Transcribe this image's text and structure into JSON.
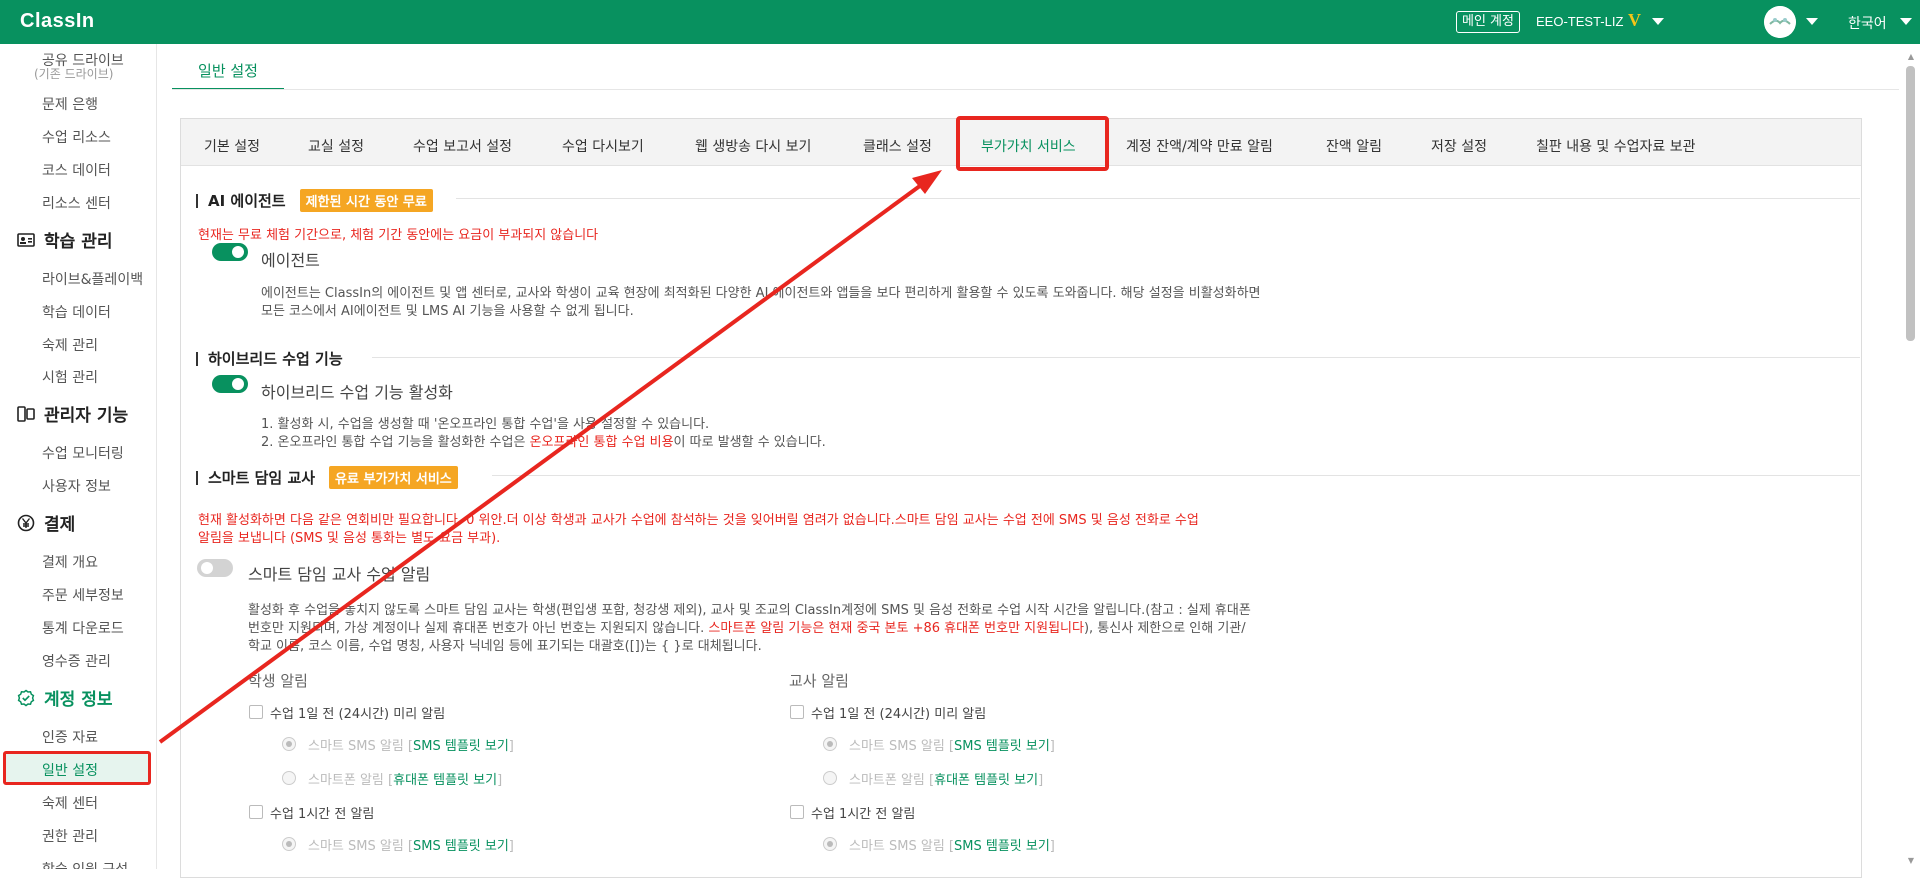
{
  "header": {
    "logo": "ClassIn",
    "main_account_label": "메인 계정",
    "account_name": "EEO-TEST-LIZ",
    "vip_badge": "V",
    "language": "한국어"
  },
  "sidebar": {
    "top_items": [
      {
        "label": "공유 드라이브",
        "sub": "(기존 드라이브)"
      },
      {
        "label": "문제 은행"
      },
      {
        "label": "수업 리소스"
      },
      {
        "label": "코스 데이터"
      },
      {
        "label": "리소스 센터"
      }
    ],
    "groups": [
      {
        "title": "학습 관리",
        "icon": "id-card-icon",
        "items": [
          "라이브&플레이백",
          "학습 데이터",
          "숙제 관리",
          "시험 관리"
        ]
      },
      {
        "title": "관리자 기능",
        "icon": "admin-device-icon",
        "items": [
          "수업 모니터링",
          "사용자 정보"
        ]
      },
      {
        "title": "결제",
        "icon": "yen-circle-icon",
        "items": [
          "결제 개요",
          "주문 세부정보",
          "통계 다운로드",
          "영수증 관리"
        ]
      },
      {
        "title": "계정 정보",
        "icon": "account-check-icon",
        "items": [
          "인증 자료",
          "일반 설정",
          "숙제 센터",
          "권한 관리",
          "학습 인원 구성"
        ]
      }
    ],
    "active_item": "일반 설정"
  },
  "page": {
    "tab": "일반 설정"
  },
  "tabs": [
    "기본 설정",
    "교실 설정",
    "수업 보고서 설정",
    "수업 다시보기",
    "웹 생방송 다시 보기",
    "클래스 설정",
    "부가가치 서비스",
    "계정 잔액/계약 만료 알림",
    "잔액 알림",
    "저장 설정",
    "칠판 내용 및 수업자료 보관"
  ],
  "active_tab": "부가가치 서비스",
  "sections": {
    "ai": {
      "title": "AI 에이전트",
      "badge": "제한된 시간 동안 무료",
      "notice": "현재는 무료 체험 기간으로, 체험 기간 동안에는 요금이 부과되지 않습니다",
      "toggle_label": "에이전트",
      "toggle_on": true,
      "desc_line1": "에이전트는 ClassIn의 에이전트 및 앱 센터로, 교사와 학생이 교육 현장에 최적화된 다양한 AI 에이전트와 앱들을 보다 편리하게 활용할 수 있도록 도와줍니다. 해당 설정을 비활성화하면",
      "desc_line2": "모든 코스에서 AI에이전트 및 LMS AI 기능을 사용할 수 없게 됩니다."
    },
    "hybrid": {
      "title": "하이브리드 수업 기능",
      "toggle_label": "하이브리드 수업 기능 활성화",
      "toggle_on": true,
      "line1": "1. 활성화 시, 수업을 생성할 때 '온오프라인 통합 수업'을 사용 설정할 수 있습니다.",
      "line2_pre": "2. 온오프라인 통합 수업 기능을 활성화한 수업은 ",
      "line2_red": "온오프라인 통합 수업 비용",
      "line2_post": "이 따로 발생할 수 있습니다."
    },
    "smart": {
      "title": "스마트 담임 교사",
      "badge": "유료 부가가치 서비스",
      "notice_line1": "현재 활성화하면 다음 같은 연회비만 필요합니다. 0 위안.더 이상 학생과 교사가 수업에 참석하는 것을 잊어버릴 염려가 없습니다.스마트 담임 교사는 수업 전에 SMS 및 음성 전화로 수업",
      "notice_line2": "알림을 보냅니다 (SMS 및 음성 통화는 별도 요금 부과).",
      "toggle_label": "스마트 담임 교사 수업 알림",
      "toggle_on": false,
      "desc_line1": "활성화 후 수업을 놓치지 않도록 스마트 담임 교사는 학생(편입생 포함, 청강생 제외), 교사 및 조교의 ClassIn계정에 SMS 및 음성 전화로 수업 시작 시간을 알립니다.(참고 : 실제 휴대폰",
      "desc_line2_pre": "번호만 지원되며, 가상 계정이나 실제 휴대폰 번호가 아닌 번호는 지원되지 않습니다. ",
      "desc_line2_red": "스마트폰 알림 기능은 현재 중국 본토 +86 휴대폰 번호만 지원됩니다",
      "desc_line2_post": "), 통신사 제한으로 인해 기관/",
      "desc_line3": "학교 이름, 코스 이름, 수업 명칭, 사용자 닉네임 등에 표기되는 대괄호([])는 { }로 대체됩니다.",
      "student_col": "학생 알림",
      "teacher_col": "교사 알림",
      "opt_24h": "수업 1일 전 (24시간) 미리 알림",
      "opt_1h": "수업 1시간 전 알림",
      "sms_alert": "스마트 SMS 알림 [",
      "sms_link": "SMS 템플릿 보기",
      "phone_alert": "스마트폰 알림 [",
      "phone_link": "휴대폰 템플릿 보기",
      "close_bracket": "]"
    }
  },
  "colors": {
    "brand": "#08915f",
    "annotation": "#e8261f",
    "badge": "#f5a623"
  }
}
